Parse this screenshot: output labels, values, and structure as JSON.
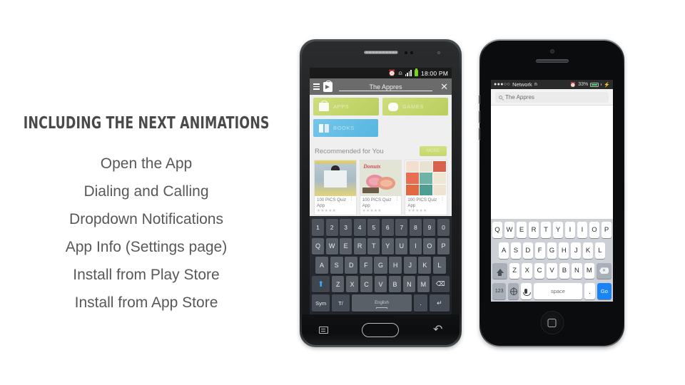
{
  "slide": {
    "title": "INCLUDING THE NEXT ANIMATIONS",
    "bullets": [
      "Open the App",
      "Dialing and Calling",
      "Dropdown Notifications",
      "App Info (Settings page)",
      "Install from Play Store",
      "Install from App Store"
    ],
    "background_color": "#ffffff",
    "title_color": "#4a4a4a",
    "bullet_color": "#585858"
  },
  "android": {
    "status_bar": {
      "clock": "18:00 PM",
      "icons": [
        "alarm-icon",
        "wifi-icon",
        "signal-icon",
        "battery-icon"
      ],
      "background_color": "#1a1a1a"
    },
    "action_bar": {
      "menu_icon": "hamburger-icon",
      "app_icon": "play-store-icon",
      "search_value": "The Appres",
      "close_icon": "close-icon",
      "background_color": "#6b6b6b"
    },
    "chips": [
      {
        "label": "APPS",
        "color": "#c6d86e",
        "icon": "bag-icon"
      },
      {
        "label": "GAMES",
        "color": "#c6d86e",
        "icon": "gamepad-icon"
      },
      {
        "label": "BOOKS",
        "color": "#63bde5",
        "icon": "book-icon"
      }
    ],
    "section": {
      "title": "Recommended for You",
      "more_label": "MORE",
      "more_color": "#c6d86e"
    },
    "cards": [
      {
        "name": "100 PICS Quiz App",
        "stars": "★★★★★",
        "overflow": "⋮"
      },
      {
        "name": "100 PICS Quiz App",
        "stars": "★★★★★",
        "overflow": "⋮"
      },
      {
        "name": "100 PICS Quiz App",
        "stars": "★★★★★",
        "overflow": "⋮"
      }
    ],
    "keyboard": {
      "number_row": [
        "1",
        "2",
        "3",
        "4",
        "5",
        "6",
        "7",
        "8",
        "9",
        "0"
      ],
      "row1": [
        "Q",
        "W",
        "E",
        "R",
        "T",
        "Y",
        "U",
        "I",
        "O",
        "P"
      ],
      "row2": [
        "A",
        "S",
        "D",
        "F",
        "G",
        "H",
        "J",
        "K",
        "L"
      ],
      "row3": [
        "Z",
        "X",
        "C",
        "V",
        "B",
        "N",
        "M"
      ],
      "shift_icon": "shift-arrow-icon",
      "delete_icon": "backspace-icon",
      "sym_label": "Sym",
      "text_mode_label": "T/",
      "space_label": "English",
      "space_left_arrow": "◀",
      "space_right_arrow": "▶",
      "period_label": ".",
      "enter_icon": "enter-icon"
    },
    "nav_bar": {
      "menu_icon": "menu-icon",
      "home_icon": "home-icon",
      "back_icon": "back-icon"
    }
  },
  "iphone": {
    "status_bar": {
      "signal_dots": "●●●○○",
      "carrier": "Network",
      "wifi_icon": "wifi-icon",
      "alarm_icon": "alarm-icon",
      "battery_percent": "33%",
      "bolt_icon": "charging-bolt-icon",
      "background_color": "#2b2b2b"
    },
    "search": {
      "value": "The Appres",
      "icon": "search-icon"
    },
    "keyboard": {
      "row1": [
        "Q",
        "W",
        "E",
        "R",
        "T",
        "Y",
        "I",
        "I",
        "O",
        "P"
      ],
      "row2": [
        "A",
        "S",
        "D",
        "F",
        "G",
        "H",
        "J",
        "K",
        "L"
      ],
      "row3": [
        "Z",
        "X",
        "C",
        "V",
        "B",
        "N",
        "M"
      ],
      "shift_icon": "shift-arrow-icon",
      "delete_icon": "backspace-icon",
      "num_label": "123",
      "globe_icon": "globe-icon",
      "mic_icon": "microphone-icon",
      "space_label": "space",
      "period_label": ".",
      "go_label": "Go",
      "go_color": "#1a84f7",
      "background_color": "#cdd1d7"
    },
    "home_button": "home-button"
  }
}
